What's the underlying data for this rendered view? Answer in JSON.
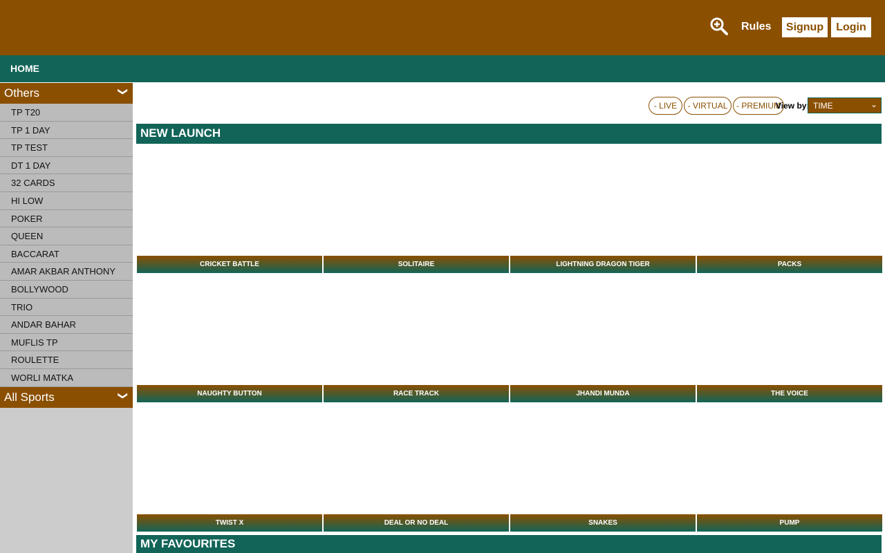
{
  "header": {
    "rules": "Rules",
    "signup": "Signup",
    "login": "Login"
  },
  "nav": {
    "home": "HOME"
  },
  "sidebar": {
    "others": "Others",
    "items": [
      "TP T20",
      "TP 1 DAY",
      "TP TEST",
      "DT 1 DAY",
      "32 CARDS",
      "HI LOW",
      "POKER",
      "QUEEN",
      "BACCARAT",
      "AMAR AKBAR ANTHONY",
      "BOLLYWOOD",
      "TRIO",
      "ANDAR BAHAR",
      "MUFLIS TP",
      "ROULETTE",
      "WORLI MATKA"
    ],
    "all_sports": "All Sports"
  },
  "filters": {
    "live": "- LIVE",
    "virtual": "- VIRTUAL",
    "premium": "- PREMIUM",
    "view_by": "View by:",
    "selected": "TIME"
  },
  "sections": {
    "new_launch": "NEW LAUNCH",
    "favourites": "MY FAVOURITES"
  },
  "games": [
    "CRICKET BATTLE",
    "SOLITAIRE",
    "LIGHTNING DRAGON TIGER",
    "PACKS",
    "NAUGHTY BUTTON",
    "RACE TRACK",
    "JHANDI MUNDA",
    "THE VOICE",
    "TWIST X",
    "DEAL OR NO DEAL",
    "SNAKES",
    "PUMP"
  ],
  "colors": {
    "brown": "#8b4f00",
    "teal": "#126458"
  }
}
